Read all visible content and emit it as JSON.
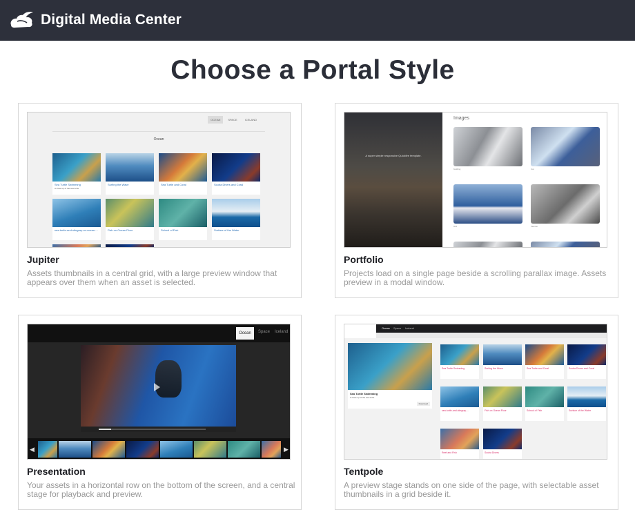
{
  "header": {
    "app_title": "Digital Media Center",
    "logo_icon": "cloud-bird-logo",
    "background": "#2d303b"
  },
  "page": {
    "title": "Choose a Portal Style"
  },
  "cards": [
    {
      "name": "Jupiter",
      "description": "Assets thumbnails in a central grid, with a large preview window that appears over them when an asset is selected.",
      "thumb": {
        "tabs": [
          "OCEAN",
          "SPACE",
          "ICELAND"
        ],
        "gallery_title": "Ocean",
        "tiles": [
          {
            "caption": "Sea Turtle Swimming",
            "sub": "A close up of the sea turtle"
          },
          {
            "caption": "Surfing the Wave",
            "sub": ""
          },
          {
            "caption": "Sea Turtle and Coral",
            "sub": ""
          },
          {
            "caption": "Scuba Divers and Coral",
            "sub": ""
          },
          {
            "caption": "sea-turtle-and-stingray-on-ocean-...",
            "sub": ""
          },
          {
            "caption": "Fish on Ocean Floor",
            "sub": ""
          },
          {
            "caption": "School of Fish",
            "sub": ""
          },
          {
            "caption": "Surface of the Water",
            "sub": ""
          }
        ]
      }
    },
    {
      "name": "Portfolio",
      "description": "Projects load on a single page beside a scrolling parallax image. Assets preview in a modal window.",
      "thumb": {
        "heading": "Images",
        "tagline": "A super simple responsive Quickfire template.",
        "captions": [
          "building",
          "Car",
          "bird",
          "Vaunter"
        ]
      }
    },
    {
      "name": "Presentation",
      "description": "Your assets in a horizontal row on the bottom of the screen, and a central stage for playback and preview.",
      "thumb": {
        "tabs": [
          "Ocean",
          "Space",
          "Iceland"
        ]
      }
    },
    {
      "name": "Tentpole",
      "description": "A preview stage stands on one side of the page, with selectable asset thumbnails in a grid beside it.",
      "thumb": {
        "tabs": [
          "Ocean",
          "Space",
          "Iceland"
        ],
        "hero_title": "Sea Turtle Swimming",
        "hero_sub": "A close up of the sea turtle",
        "download_label": "Download",
        "tiles": [
          "Sea Turtle Swimming",
          "Surfing the Wave",
          "Sea Turtle and Coral",
          "Scuba Divers and Coral",
          "sea-turtle-and-stingray-...",
          "Fish on Ocean Floor",
          "School of Fish",
          "Surface of the Water",
          "Reef and Fish",
          "Scuba Divers"
        ]
      }
    }
  ]
}
